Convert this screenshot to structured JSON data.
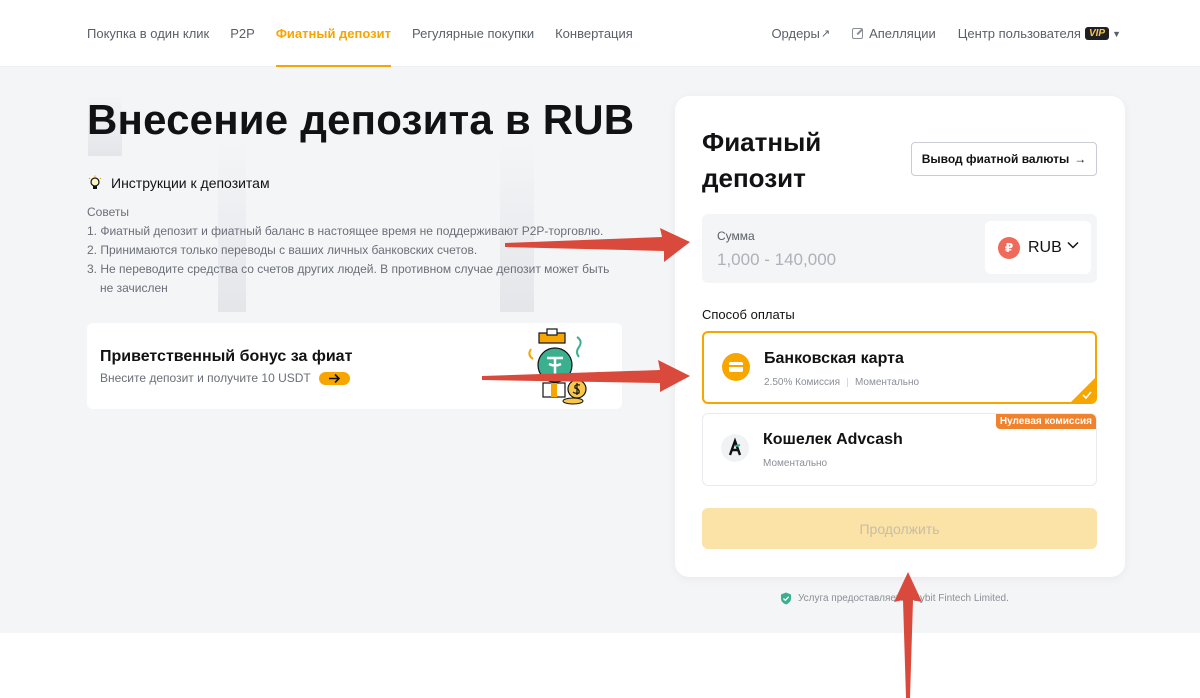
{
  "nav": {
    "left": [
      "Покупка в один клик",
      "P2P",
      "Фиатный депозит",
      "Регулярные покупки",
      "Конвертация"
    ],
    "active_index": 2,
    "orders": "Ордеры",
    "orders_arrow": "↗",
    "appeals": "Апелляции",
    "user_center": "Центр пользователя",
    "vip": "VIP"
  },
  "page": {
    "title": "Внесение депозита в RUB",
    "instructions_title": "Инструкции к депозитам",
    "tips_title": "Советы",
    "tips": [
      "1. Фиатный депозит и фиатный баланс в настоящее время не поддерживают P2P-торговлю.",
      "2. Принимаются только переводы с ваших личных банковских счетов.",
      "3. Не переводите средства со счетов других людей. В противном случае депозит может быть",
      "не зачислен"
    ]
  },
  "bonus": {
    "title": "Приветственный бонус за фиат",
    "subtitle": "Внесите депозит и получите 10 USDT"
  },
  "deposit_card": {
    "title": "Фиатный депозит",
    "withdraw_button": "Вывод фиатной валюты",
    "withdraw_arrow": "→",
    "amount_label": "Сумма",
    "amount_placeholder": "1,000 - 140,000",
    "currency_symbol": "₽",
    "currency": "RUB",
    "payment_label": "Способ оплаты",
    "options": [
      {
        "name": "Банковская карта",
        "fee": "2.50% Комиссия",
        "speed": "Моментально",
        "selected": true
      },
      {
        "name": "Кошелек Advcash",
        "speed": "Моментально",
        "badge": "Нулевая комиссия",
        "selected": false
      }
    ],
    "continue_button": "Продолжить"
  },
  "footer": {
    "provider": "Услуга предоставляется Bybit Fintech Limited."
  },
  "colors": {
    "accent": "#f7a600",
    "annotation_arrow": "#d94a3c",
    "continue_disabled": "#fbe2a6",
    "badge": "#f0822d"
  }
}
